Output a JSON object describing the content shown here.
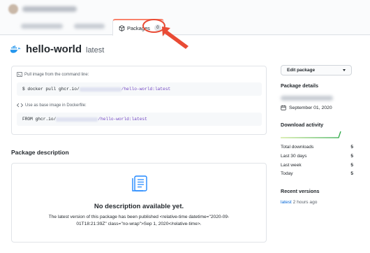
{
  "tabs": {
    "active_label": "Packages",
    "active_count": "0"
  },
  "package": {
    "name": "hello-world",
    "tag": "latest"
  },
  "commands": {
    "pull_label": "Pull image from the command line:",
    "pull_prefix": "$ docker pull ghcr.io/",
    "pull_suffix": "/hello-world:latest",
    "base_label": "Use as base image in Dockerfile:",
    "from_prefix": "FROM ghcr.io/",
    "from_suffix": "/hello-world:latest"
  },
  "description": {
    "heading": "Package description",
    "empty_title": "No description available yet.",
    "empty_text": "The latest version of this package has been published <relative-time datetime=\"2020-09-01T18:21:39Z\" class=\"no-wrap\">Sep 1, 2020</relative-time>."
  },
  "sidebar": {
    "edit_label": "Edit package",
    "details_heading": "Package details",
    "published_date": "September 01, 2020",
    "activity_heading": "Download activity",
    "stats": [
      {
        "label": "Total downloads",
        "value": "5"
      },
      {
        "label": "Last 30 days",
        "value": "5"
      },
      {
        "label": "Last week",
        "value": "5"
      },
      {
        "label": "Today",
        "value": "5"
      }
    ],
    "versions_heading": "Recent versions",
    "version_tag": "latest",
    "version_time": "2 hours ago"
  },
  "colors": {
    "accent": "#f9826c",
    "annotation": "#e94b35",
    "link": "#0366d6",
    "sparkline": "#28a745"
  }
}
